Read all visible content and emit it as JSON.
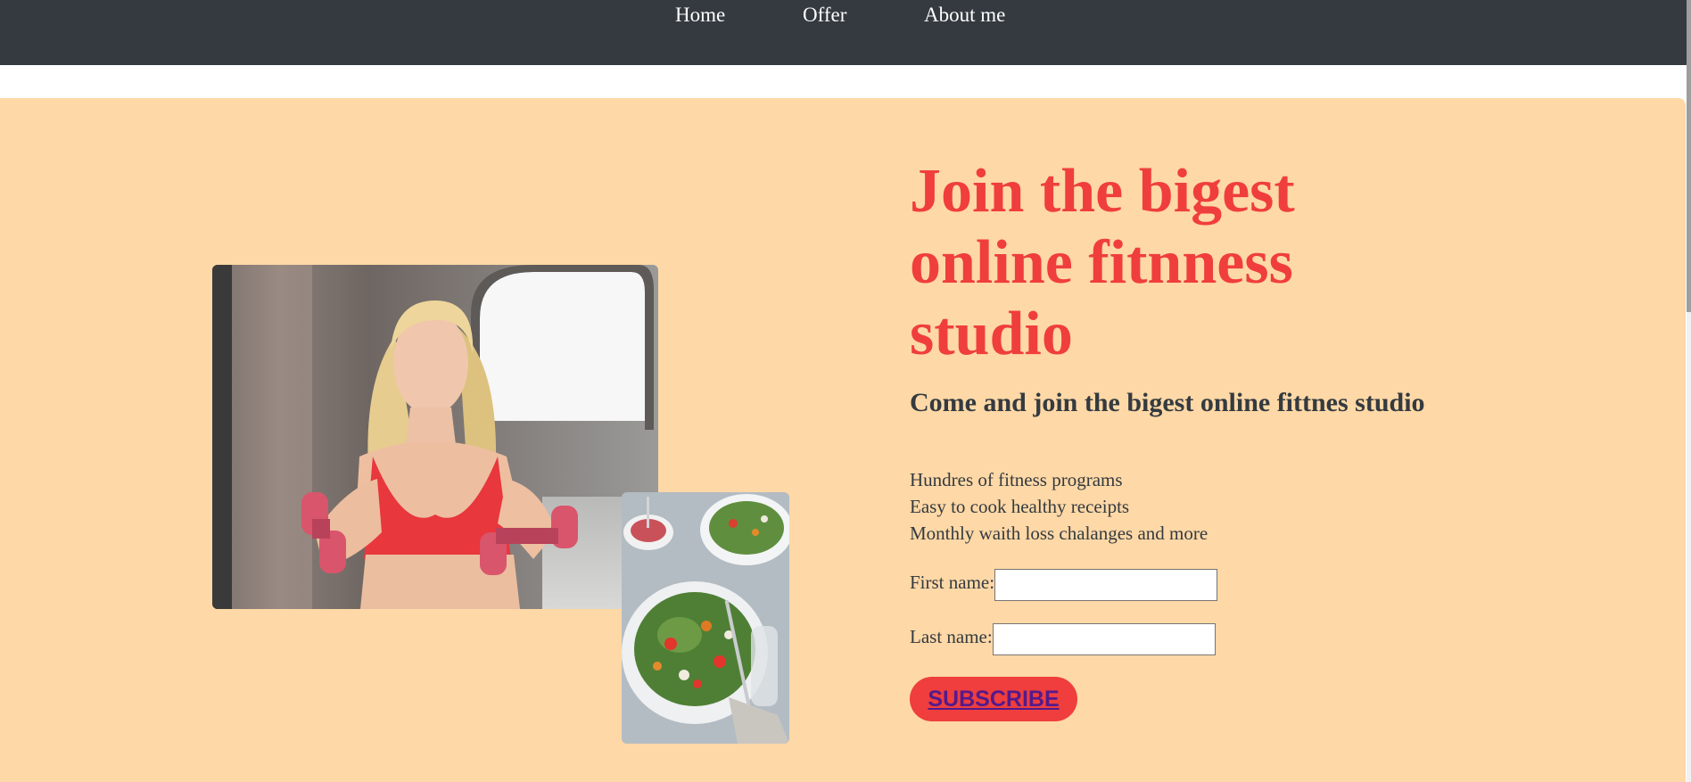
{
  "nav": {
    "items": [
      {
        "label": "Home"
      },
      {
        "label": "Offer"
      },
      {
        "label": "About me"
      }
    ]
  },
  "hero": {
    "title": "Join the bigest online fitnness studio",
    "subtitle": "Come and join the bigest online fittnes studio",
    "features": [
      "Hundres of fitness programs",
      "Easy to cook healthy receipts",
      "Monthly waith loss chalanges and more"
    ],
    "form": {
      "first_name_label": "First name:",
      "first_name_value": "",
      "last_name_label": "Last name:",
      "last_name_value": "",
      "subscribe_label": "SUBSCRIBE"
    }
  },
  "colors": {
    "navbar": "#343a40",
    "hero_background": "#fed8a6",
    "accent": "#ef3e3d",
    "body_text": "#343a40",
    "button_text": "#551a8b"
  },
  "images": {
    "main": "woman-with-dumbbells-photo",
    "secondary": "salad-bowls-photo"
  }
}
